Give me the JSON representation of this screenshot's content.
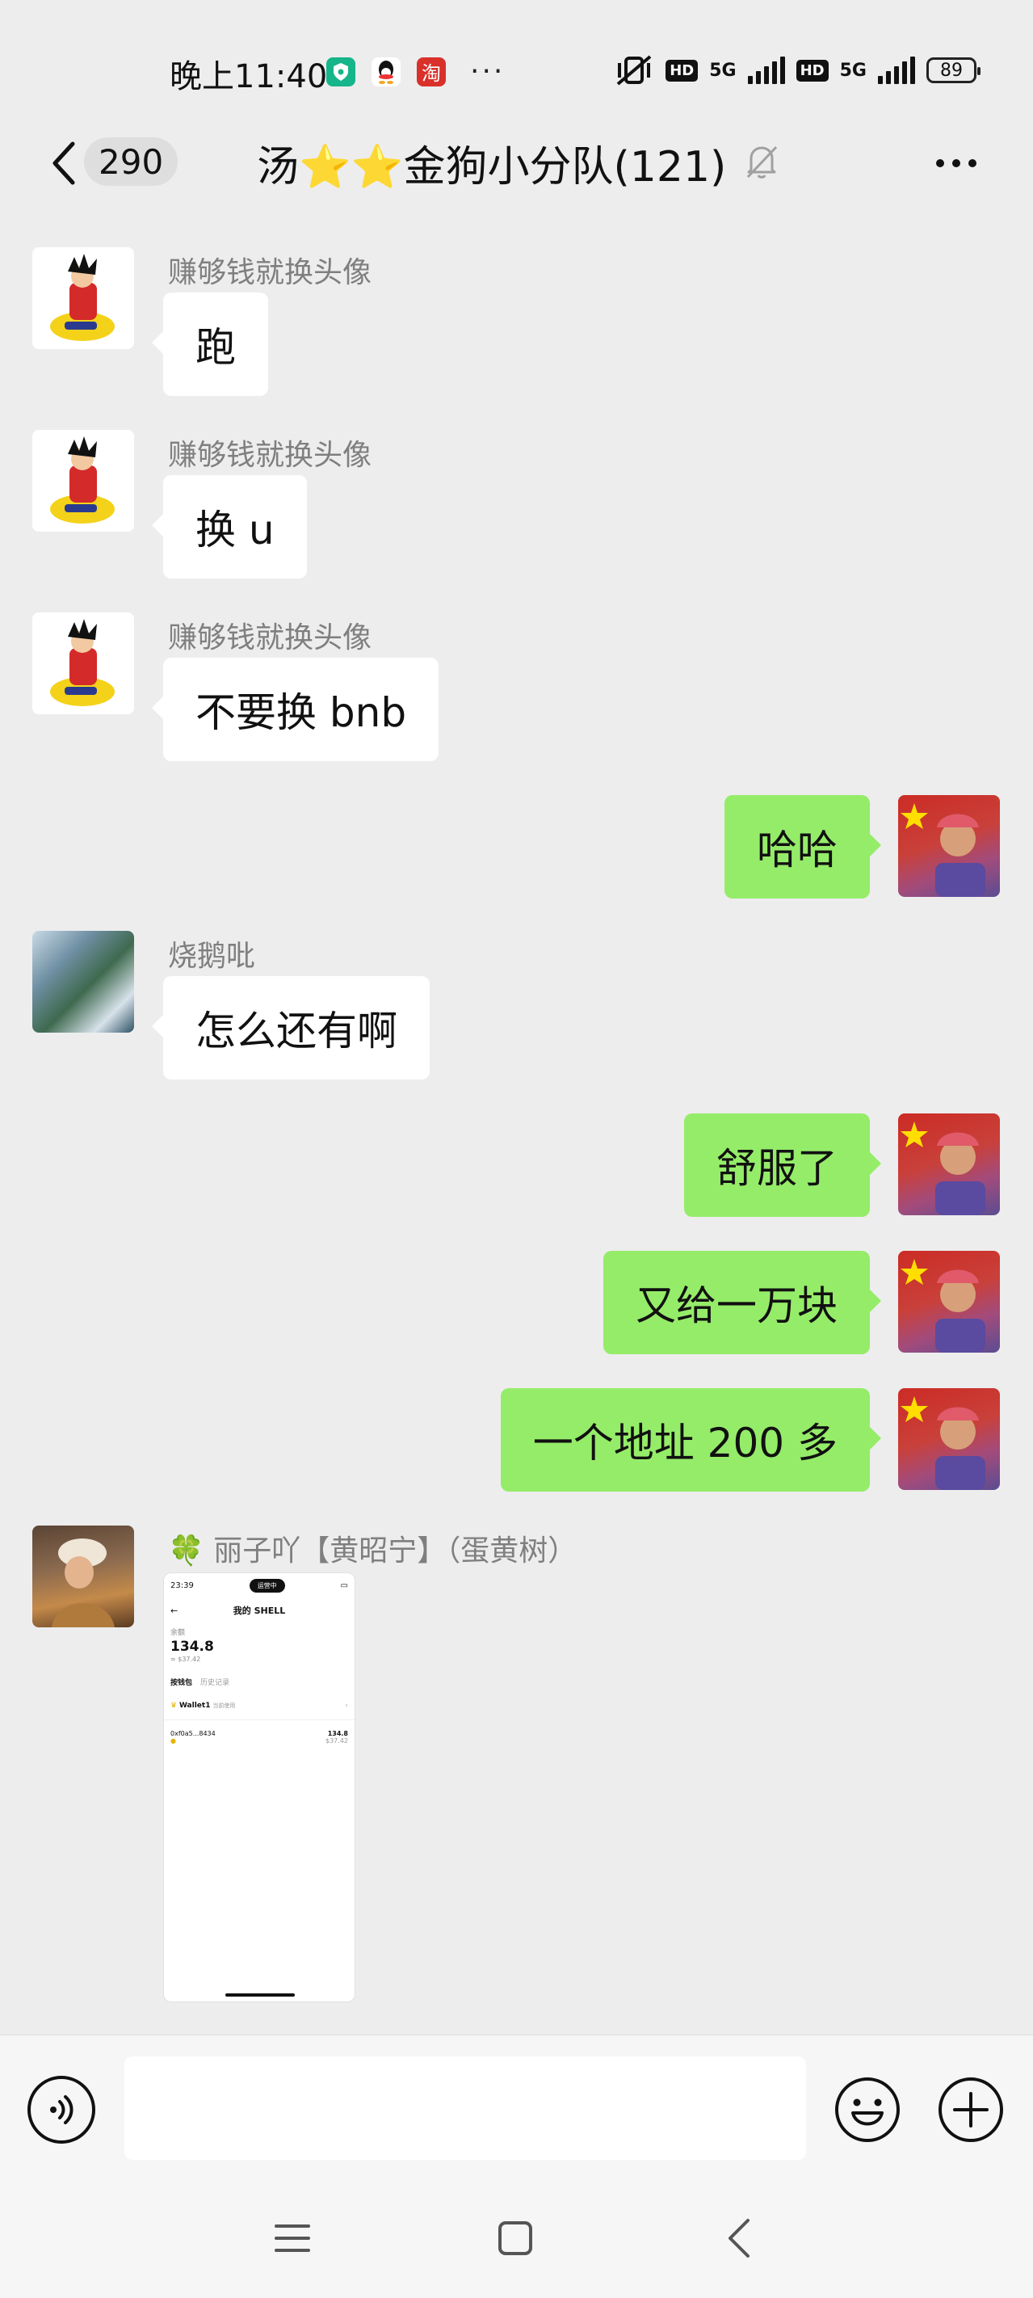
{
  "status_bar": {
    "time": "晚上11:40",
    "left_icons": [
      "shield-app-icon",
      "qq-app-icon",
      "taobao-app-icon"
    ],
    "taobao_glyph": "淘",
    "more_dots": "···",
    "hd_label": "HD",
    "network_label": "5G",
    "battery": "89"
  },
  "header": {
    "unread_count": "290",
    "title": "汤⭐⭐金狗小分队(121)",
    "mute_icon": "bell-off-icon",
    "more_icon": "more-dots-icon"
  },
  "messages": [
    {
      "sender": "赚够钱就换头像",
      "text": "跑",
      "direction": "in"
    },
    {
      "sender": "赚够钱就换头像",
      "text": "换 u",
      "direction": "in"
    },
    {
      "sender": "赚够钱就换头像",
      "text": "不要换 bnb",
      "direction": "in"
    },
    {
      "sender": "",
      "text": "哈哈",
      "direction": "out"
    },
    {
      "sender": "烧鹅吡",
      "text": "怎么还有啊",
      "direction": "in"
    },
    {
      "sender": "",
      "text": "舒服了",
      "direction": "out"
    },
    {
      "sender": "",
      "text": "又给一万块",
      "direction": "out"
    },
    {
      "sender": "",
      "text": "一个地址 200 多",
      "direction": "out"
    },
    {
      "sender": "🍀 丽子吖【黄昭宁】（蛋黄树）",
      "type": "image",
      "direction": "in"
    }
  ],
  "image_message": {
    "time": "23:39",
    "island": "运营中",
    "title": "我的 SHELL",
    "balance_label": "余额",
    "balance": "134.8",
    "balance_usd": "≈ $37.42",
    "tab_active": "按钱包",
    "tab_inactive": "历史记录",
    "wallet_name": "Wallet1",
    "wallet_tag": "当前使用",
    "address": "0xf0a5...8434",
    "row_amount": "134.8",
    "row_usd": "$37.42"
  },
  "input_bar": {
    "voice_icon": "voice-icon",
    "placeholder": "",
    "emoji_icon": "emoji-icon",
    "plus_icon": "plus-icon"
  },
  "system_nav": [
    "menu-icon",
    "home-icon",
    "back-icon"
  ]
}
